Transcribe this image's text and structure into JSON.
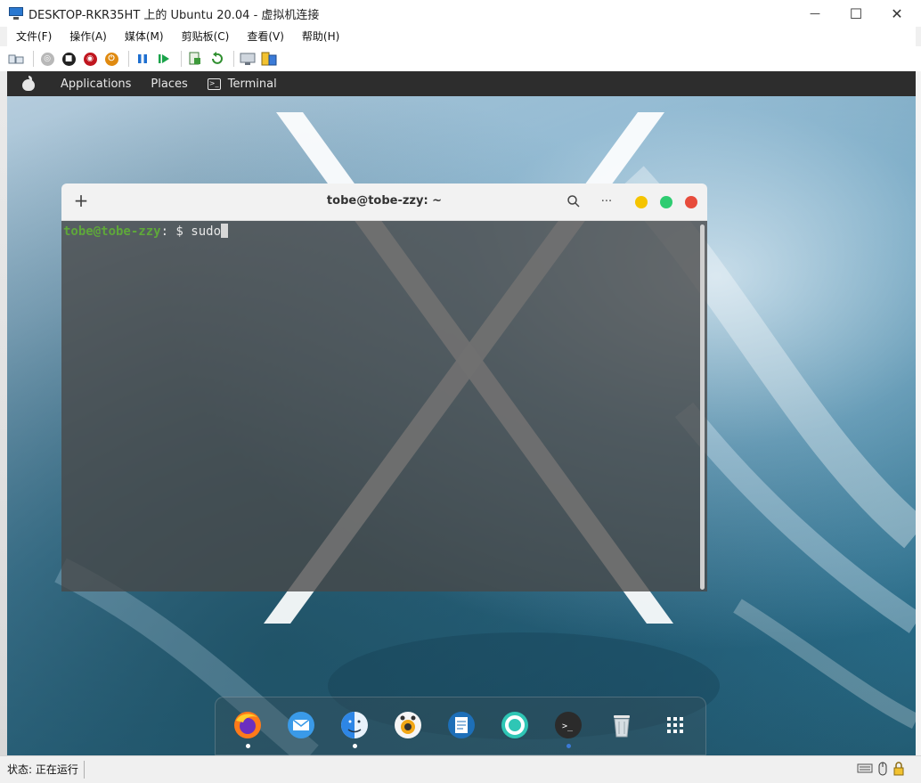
{
  "window": {
    "title": "DESKTOP-RKR35HT 上的 Ubuntu 20.04 - 虚拟机连接",
    "minimize_glyph": "—",
    "maximize_glyph": "☐",
    "close_glyph": "✕"
  },
  "menu": {
    "items": [
      {
        "label": "文件(F)"
      },
      {
        "label": "操作(A)"
      },
      {
        "label": "媒体(M)"
      },
      {
        "label": "剪贴板(C)"
      },
      {
        "label": "查看(V)"
      },
      {
        "label": "帮助(H)"
      }
    ]
  },
  "toolbar": {
    "icons": [
      "ctrl-alt-del-icon",
      "start-icon",
      "turn-off-icon",
      "shut-down-icon",
      "power-icon",
      "pause-icon",
      "resume-icon",
      "checkpoint-icon",
      "revert-icon",
      "enhanced-session-icon",
      "share-icon"
    ]
  },
  "ubuntu": {
    "topbar": {
      "applications": "Applications",
      "places": "Places",
      "terminal": "Terminal",
      "terminal_icon_glyph": ">_"
    }
  },
  "terminal": {
    "plus_glyph": "+",
    "title": "tobe@tobe-zzy: ~",
    "menu_glyph": "···",
    "prompt_user": "tobe@tobe-zzy",
    "prompt_sep": ": $ ",
    "command": "sudo",
    "colors": {
      "minimize": "#f5c400",
      "maximize": "#2ecc71",
      "close": "#e74c3c",
      "user": "#5fa83a"
    }
  },
  "dock": {
    "items": [
      {
        "name": "firefox",
        "running": true
      },
      {
        "name": "mail",
        "running": false
      },
      {
        "name": "finder",
        "running": true
      },
      {
        "name": "screenshot",
        "running": false
      },
      {
        "name": "text-editor",
        "running": false
      },
      {
        "name": "help",
        "running": false
      },
      {
        "name": "terminal",
        "running": true,
        "glyph": ">_"
      },
      {
        "name": "trash",
        "running": false
      },
      {
        "name": "app-grid",
        "running": false
      }
    ]
  },
  "status": {
    "text": "状态: 正在运行"
  }
}
